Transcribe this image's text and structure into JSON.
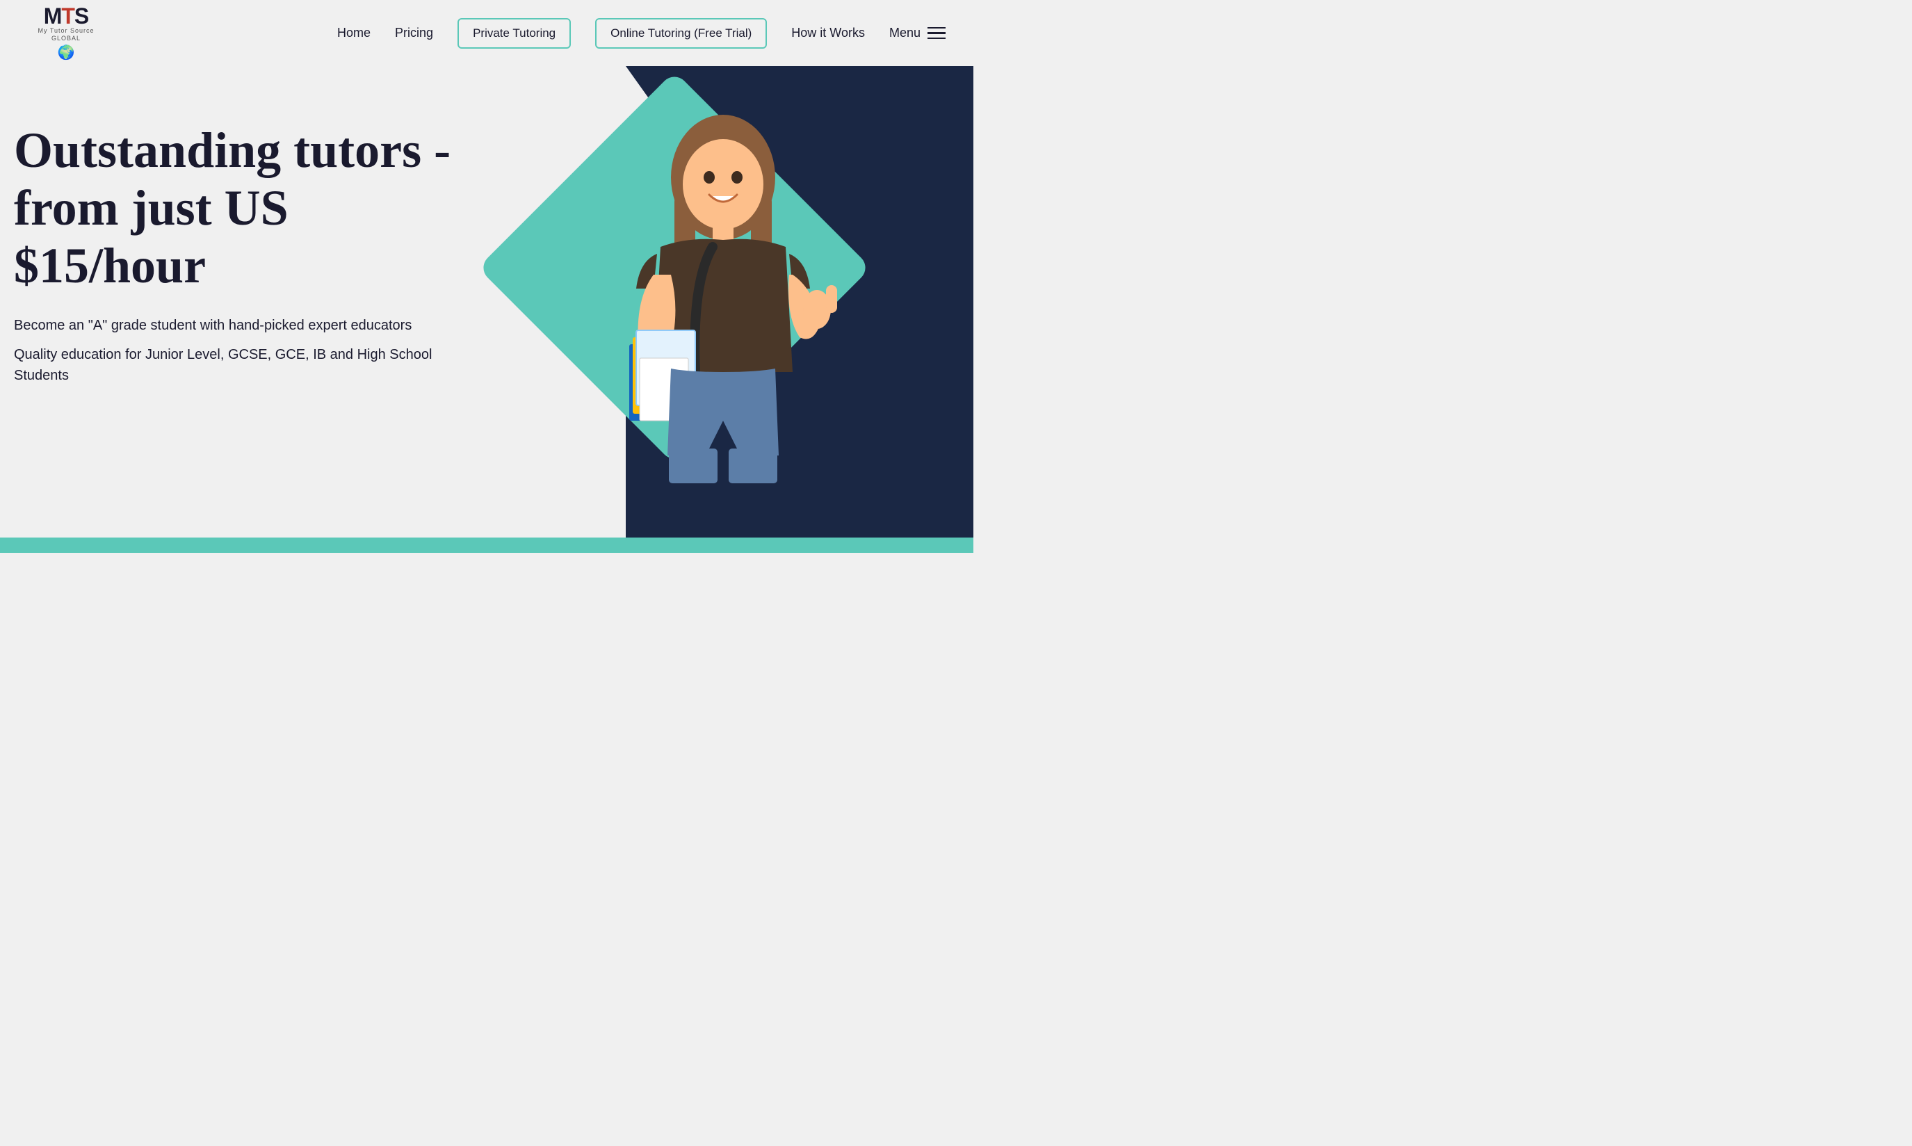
{
  "site": {
    "logo": {
      "letters": "MTS",
      "line1": "My Tutor Source",
      "line2": "GLOBAL",
      "globe_emoji": "🌍"
    }
  },
  "nav": {
    "home_label": "Home",
    "pricing_label": "Pricing",
    "private_tutoring_label": "Private Tutoring",
    "online_tutoring_label": "Online Tutoring (Free Trial)",
    "how_it_works_label": "How it Works",
    "menu_label": "Menu"
  },
  "hero": {
    "title": "Outstanding tutors - from just US $15/hour",
    "subtitle1": "Become an \"A\" grade student with hand-picked expert educators",
    "subtitle2": "Quality education for Junior Level, GCSE, GCE, IB and High School Students"
  },
  "colors": {
    "navy": "#1a2744",
    "teal": "#5bc8b8",
    "dark_text": "#1a1a2e",
    "bg": "#f0f0f0"
  }
}
